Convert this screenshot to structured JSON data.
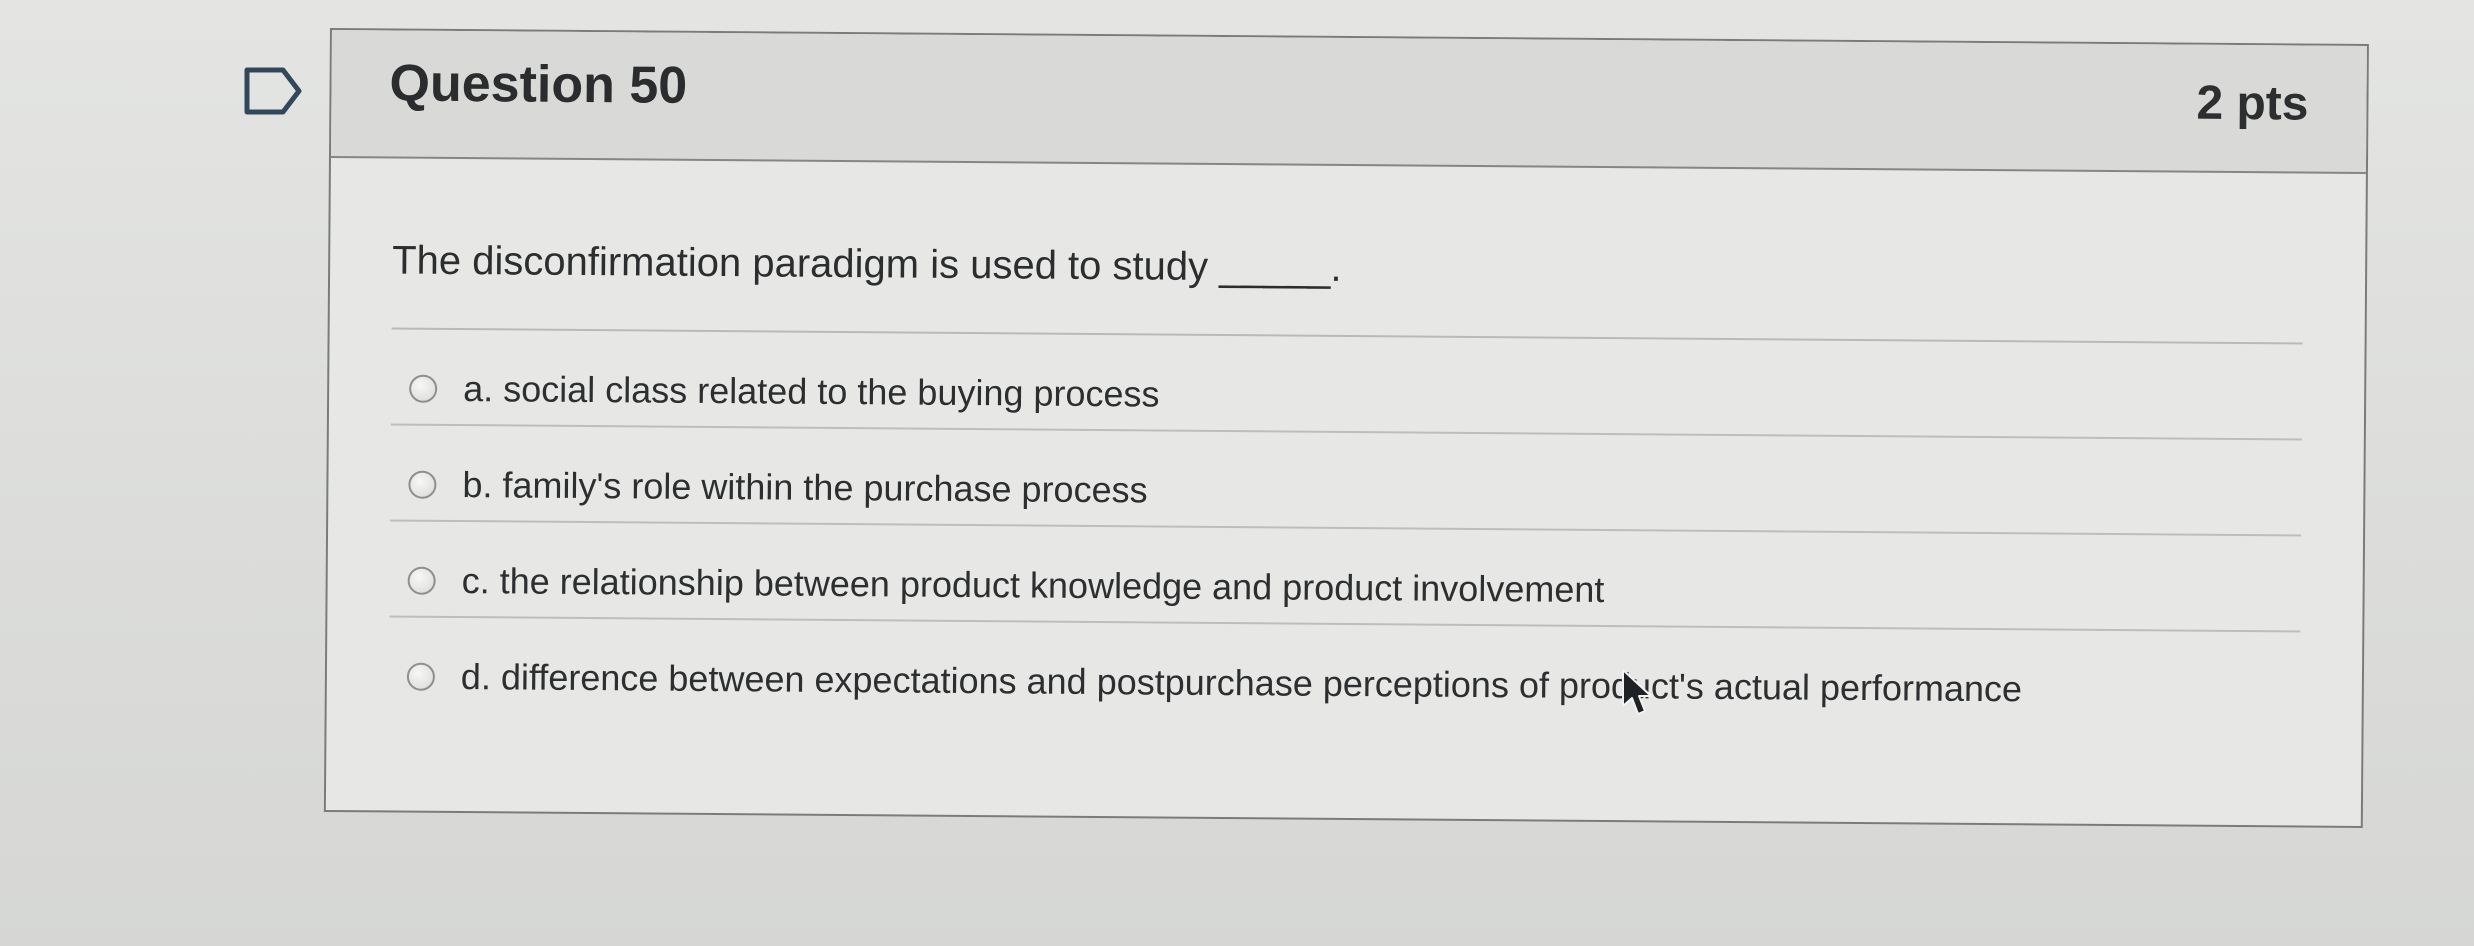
{
  "question": {
    "title": "Question 50",
    "points": "2 pts",
    "text": "The disconfirmation paradigm is used to study _____.",
    "answers": [
      {
        "label": "a. social class related to the buying process"
      },
      {
        "label": "b. family's role within the purchase process"
      },
      {
        "label": "c. the relationship between product knowledge and product involvement"
      },
      {
        "label": "d. difference between expectations and postpurchase perceptions of product's actual performance"
      }
    ]
  },
  "icons": {
    "flag": "flag-question-icon",
    "cursor": "mouse-pointer-icon"
  },
  "colors": {
    "header_background": "#d9dad8",
    "card_background": "#e7e8e6",
    "text": "#2b2d2f",
    "border": "#7a7c7c"
  }
}
